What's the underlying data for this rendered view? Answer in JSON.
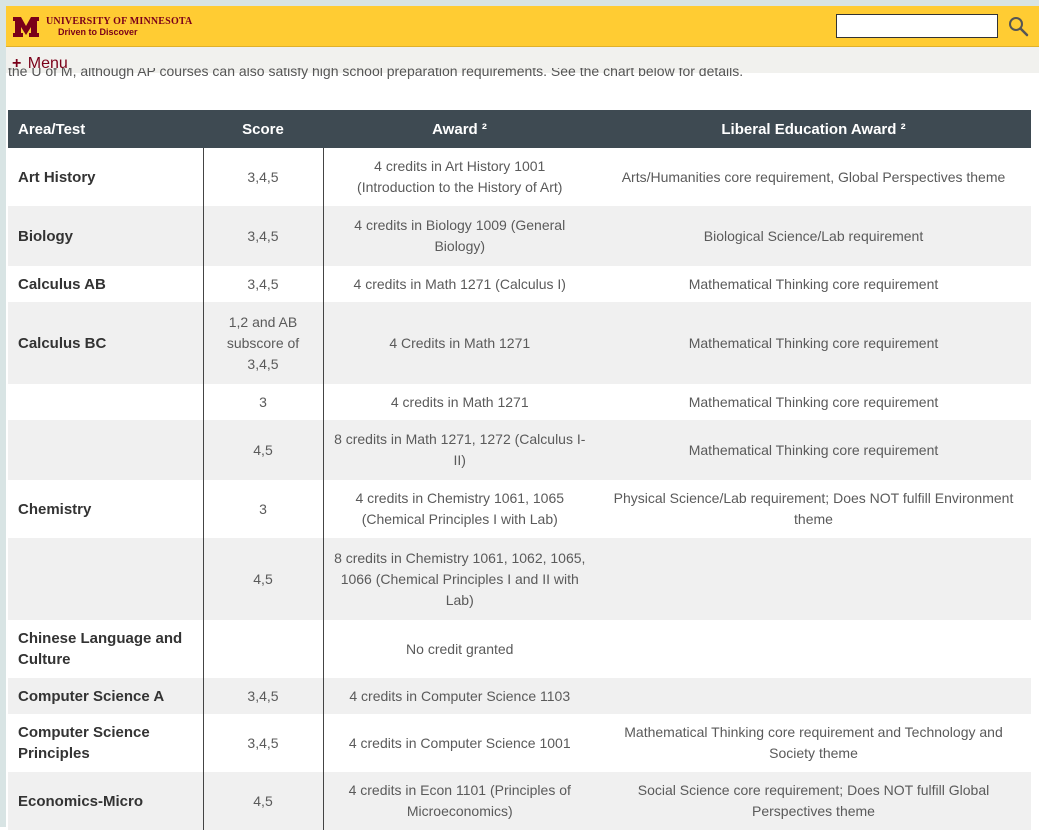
{
  "header": {
    "university_name": "UNIVERSITY OF MINNESOTA",
    "tagline": "Driven to Discover",
    "logo_icon": "block-m-logo",
    "search_placeholder": "",
    "search_icon": "magnifier-icon"
  },
  "menu": {
    "plus": "+",
    "label": "Menu"
  },
  "partial_text": "the U of M, although AP courses can also satisfy high school preparation requirements. See the chart below for details.",
  "table": {
    "headers": [
      "Area/Test",
      "Score",
      "Award ²",
      "Liberal Education Award ²"
    ],
    "rows": [
      {
        "area": "Art History",
        "score": "3,4,5",
        "award": "4 credits in Art History 1001 (Introduction to the History of Art)",
        "lib": "Arts/Humanities core requirement, Global Perspectives theme"
      },
      {
        "area": "Biology",
        "score": "3,4,5",
        "award": "4 credits in Biology 1009 (General Biology)",
        "lib": "Biological Science/Lab requirement"
      },
      {
        "area": "Calculus AB",
        "score": "3,4,5",
        "award": "4 credits in Math 1271 (Calculus I)",
        "lib": "Mathematical Thinking core requirement"
      },
      {
        "area": "Calculus BC",
        "score": "1,2 and AB subscore of 3,4,5",
        "award": "4 Credits in Math 1271",
        "lib": "Mathematical Thinking core requirement"
      },
      {
        "area": "",
        "score": "3",
        "award": "4 credits in Math 1271",
        "lib": "Mathematical Thinking core requirement"
      },
      {
        "area": "",
        "score": "4,5",
        "award": "8 credits in Math 1271, 1272 (Calculus I-II)",
        "lib": "Mathematical Thinking core requirement"
      },
      {
        "area": "Chemistry",
        "score": "3",
        "award": "4 credits in Chemistry 1061, 1065 (Chemical Principles I with Lab)",
        "lib": "Physical Science/Lab requirement; Does NOT fulfill Environment theme"
      },
      {
        "area": "",
        "score": "4,5",
        "award": "8 credits in Chemistry 1061, 1062, 1065, 1066 (Chemical Principles I and II with Lab)",
        "lib": ""
      },
      {
        "area": "Chinese Language and Culture",
        "score": "",
        "award": "No credit granted",
        "lib": ""
      },
      {
        "area": "Computer Science A",
        "score": "3,4,5",
        "award": "4 credits in Computer Science 1103",
        "lib": ""
      },
      {
        "area": "Computer Science Principles",
        "score": "3,4,5",
        "award": "4 credits in Computer Science 1001",
        "lib": "Mathematical Thinking core requirement and Technology and Society theme"
      },
      {
        "area": "Economics-Micro",
        "score": "4,5",
        "award": "4 credits in Econ 1101 (Principles of Microeconomics)",
        "lib": "Social Science core requirement; Does NOT fulfill Global Perspectives theme"
      }
    ]
  },
  "colors": {
    "maroon": "#7a0019",
    "gold": "#ffcc33",
    "header_bg": "#3e4a52",
    "stripe": "#f0f0f0"
  }
}
